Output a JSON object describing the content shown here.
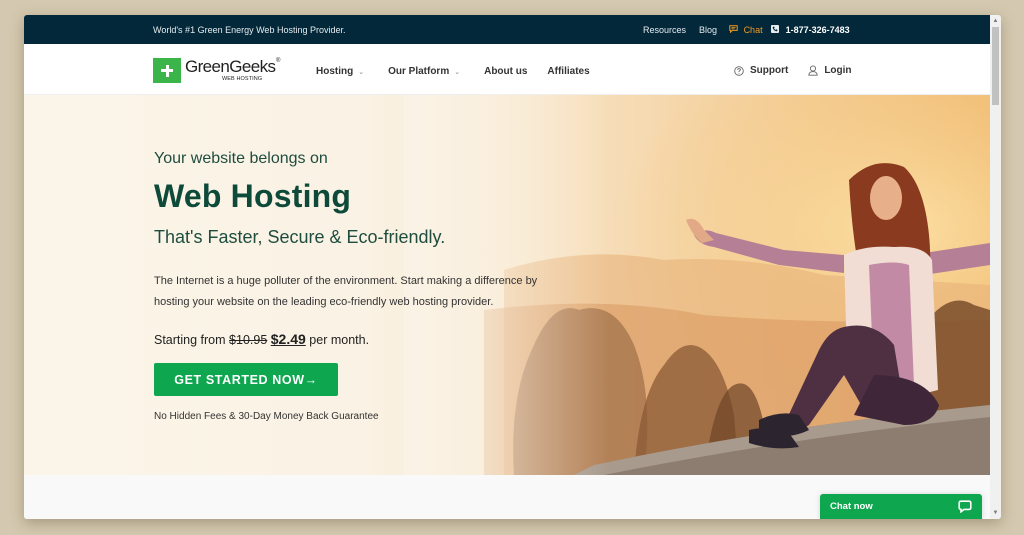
{
  "topbar": {
    "tagline": "World's #1 Green Energy Web Hosting Provider.",
    "resources": "Resources",
    "blog": "Blog",
    "chat": "Chat",
    "phone": "1-877-326-7483"
  },
  "nav": {
    "logo_name": "GreenGeeks",
    "logo_reg": "®",
    "logo_sub": "WEB HOSTING",
    "items": [
      {
        "label": "Hosting",
        "chevron": "⌄"
      },
      {
        "label": "Our Platform",
        "chevron": "⌄"
      },
      {
        "label": "About us"
      },
      {
        "label": "Affiliates"
      }
    ],
    "support": "Support",
    "login": "Login"
  },
  "hero": {
    "kicker": "Your website belongs on",
    "title": "Web Hosting",
    "subtitle": "That's Faster, Secure & Eco-friendly.",
    "desc_line1": "The Internet is a huge polluter of the environment. Start making a difference by",
    "desc_line2": "hosting your website on the leading eco-friendly web hosting provider.",
    "price_prefix": "Starting from",
    "price_old": "$10.95",
    "price_new": "$2.49",
    "price_suffix": "per month.",
    "cta": "GET STARTED NOW→",
    "guarantee": "No Hidden Fees & 30-Day Money Back Guarantee"
  },
  "chat_widget": {
    "label": "Chat now"
  },
  "colors": {
    "topbar_bg": "#02283a",
    "brand_green": "#0ea64f",
    "logo_green": "#3bb54a",
    "heading_green": "#0e4a3a",
    "chat_orange": "#f29a22"
  }
}
